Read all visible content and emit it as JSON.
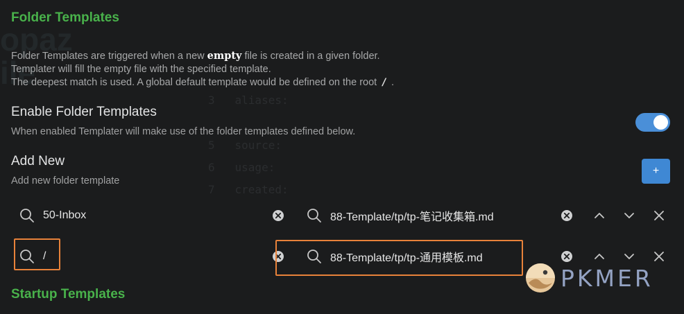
{
  "folder_templates": {
    "heading": "Folder Templates",
    "desc_line1_before": "Folder Templates are triggered when a new ",
    "desc_line1_strong": "empty",
    "desc_line1_after": " file is created in a given folder.",
    "desc_line2": "Templater will fill the empty file with the specified template.",
    "desc_line3_before": "The deepest match is used. A global default template would be defined on the root",
    "desc_line3_code": "/",
    "desc_line3_after": "."
  },
  "enable_setting": {
    "name": "Enable Folder Templates",
    "description": "When enabled Templater will make use of the folder templates defined below.",
    "enabled": true
  },
  "add_new": {
    "name": "Add New",
    "description": "Add new folder template",
    "button_label": "+"
  },
  "rows": [
    {
      "folder": "50-Inbox",
      "template": "88-Template/tp/tp-笔记收集箱.md"
    },
    {
      "folder": "/",
      "template": "88-Template/tp/tp-通用模板.md"
    }
  ],
  "startup_templates": {
    "heading": "Startup Templates"
  },
  "logo": {
    "text": "PKMER"
  },
  "colors": {
    "heading": "#49b24b",
    "accent": "#4a8fd8",
    "highlight": "#e8823a"
  }
}
